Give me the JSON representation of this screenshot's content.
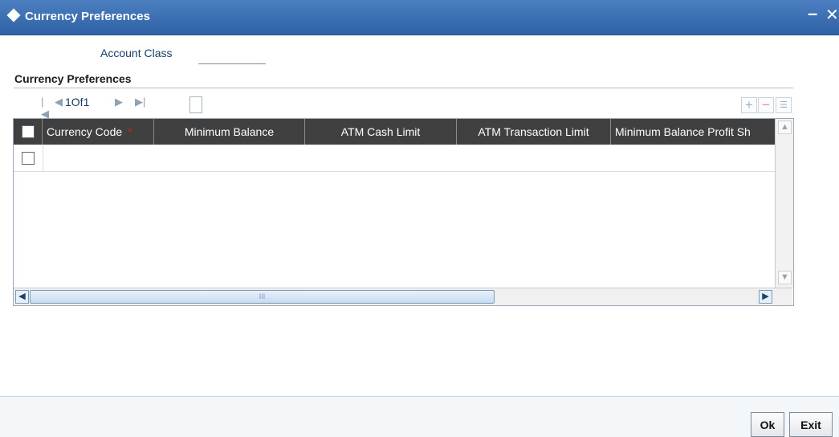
{
  "window": {
    "title": "Currency Preferences",
    "minimize_glyph": "–",
    "close_glyph": "✕"
  },
  "form": {
    "account_class_label": "Account Class",
    "account_class_value": ""
  },
  "section": {
    "title": "Currency Preferences"
  },
  "pager": {
    "first_icon": "first-page-icon",
    "prev_icon": "prev-page-icon",
    "text": "1Of1",
    "next_icon": "next-page-icon",
    "last_icon": "last-page-icon",
    "page_input_value": ""
  },
  "toolbar": {
    "add_icon": "plus-icon",
    "delete_icon": "minus-icon",
    "single_view_icon": "list-icon"
  },
  "grid": {
    "columns": [
      {
        "label": "Currency Code",
        "required": true
      },
      {
        "label": "Minimum Balance"
      },
      {
        "label": "ATM Cash Limit"
      },
      {
        "label": "ATM Transaction Limit"
      },
      {
        "label": "Minimum Balance Profit Sh"
      }
    ],
    "required_marker": "*",
    "rows": [
      {
        "checked": false,
        "currency_code": "",
        "minimum_balance": "",
        "atm_cash_limit": "",
        "atm_transaction_limit": "",
        "min_balance_profit_sharing": ""
      }
    ],
    "hscroll_thumb_glyph": "III"
  },
  "footer": {
    "ok_label": "Ok",
    "exit_label": "Exit"
  },
  "colors": {
    "titlebar": "#3a6fb3",
    "grid_header": "#404040",
    "required": "#cc2222"
  }
}
